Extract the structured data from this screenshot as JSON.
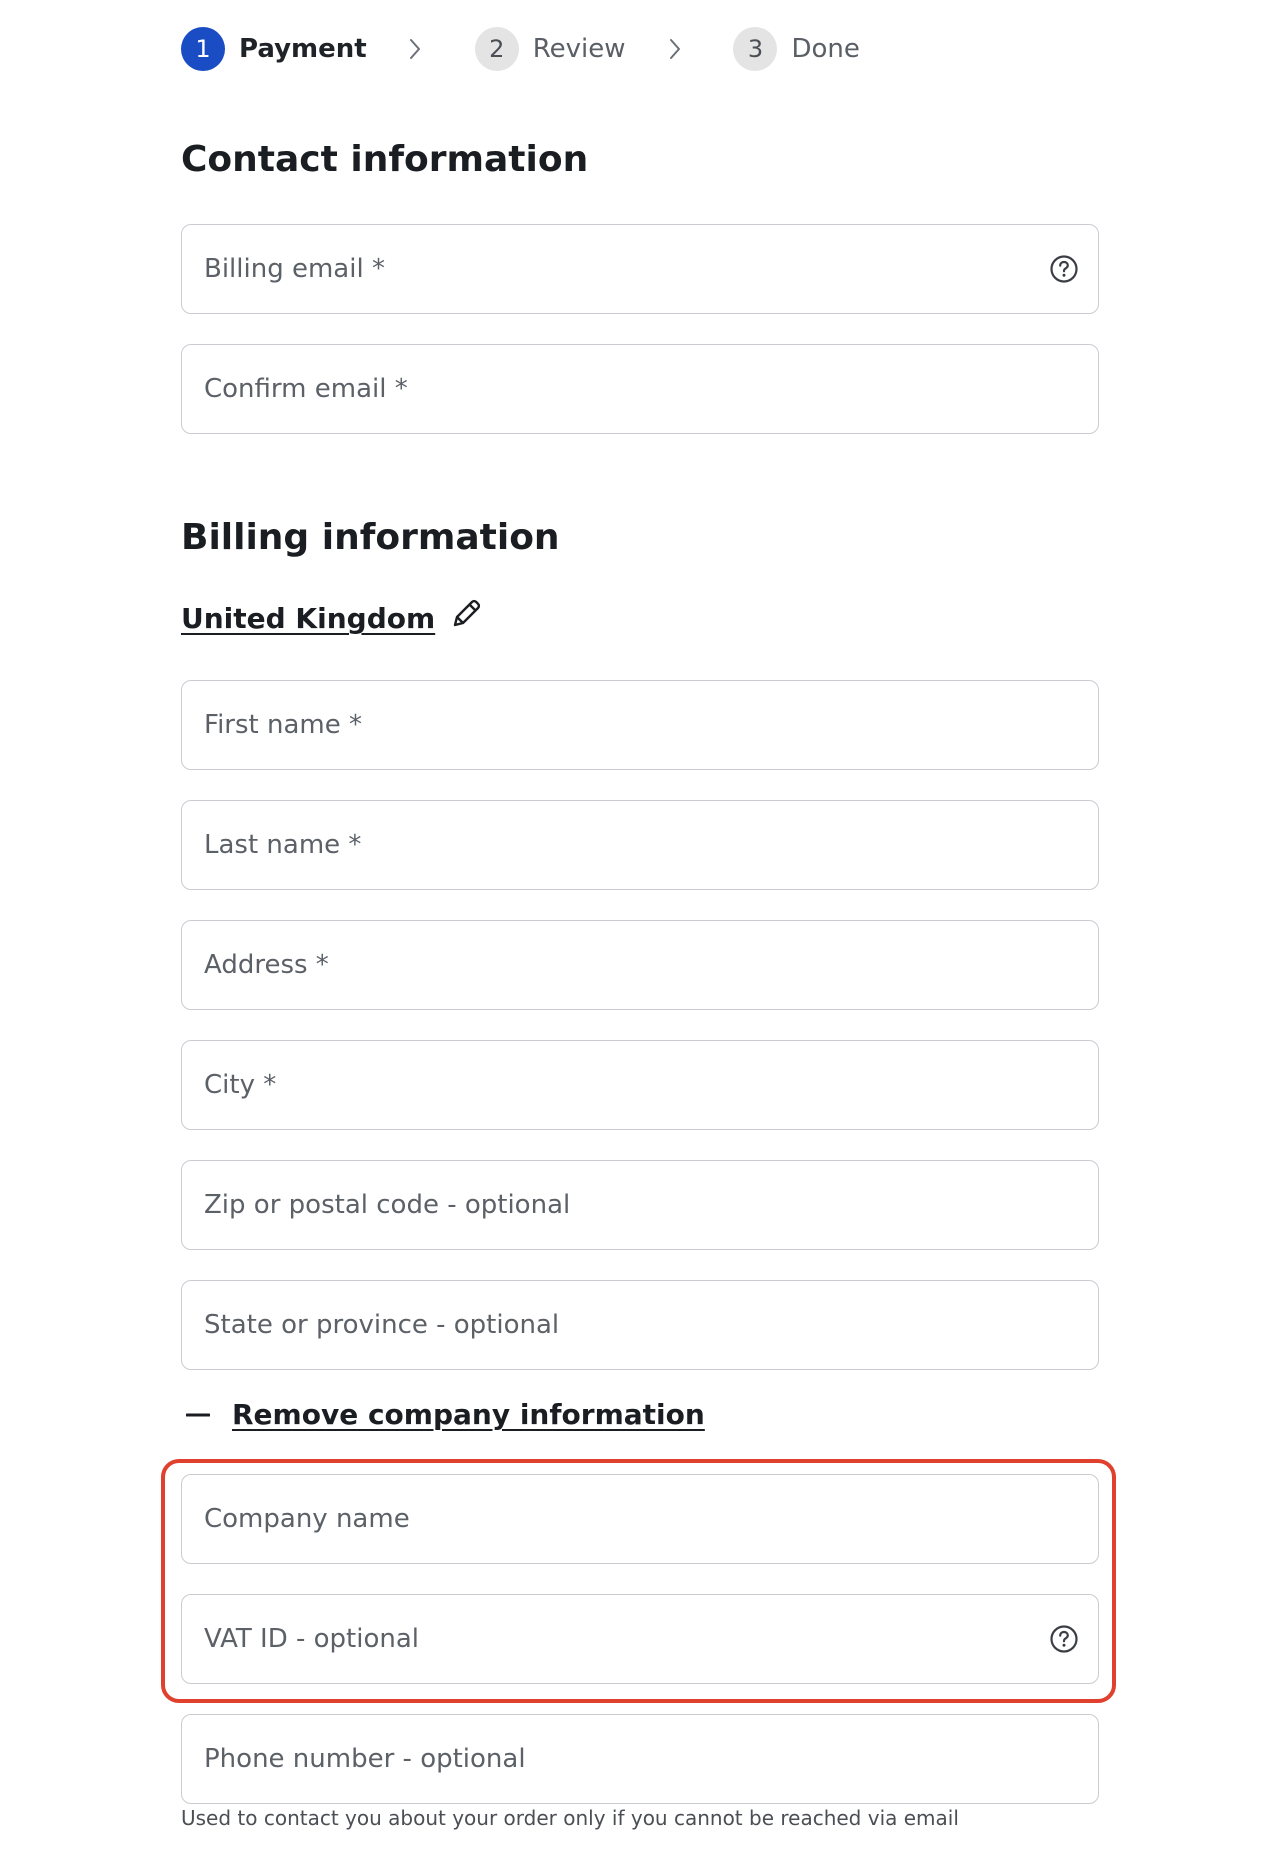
{
  "stepper": {
    "steps": [
      {
        "number": "1",
        "label": "Payment",
        "active": true
      },
      {
        "number": "2",
        "label": "Review",
        "active": false
      },
      {
        "number": "3",
        "label": "Done",
        "active": false
      }
    ]
  },
  "contact": {
    "title": "Contact information",
    "billing_email_placeholder": "Billing email *",
    "confirm_email_placeholder": "Confirm email *"
  },
  "billing": {
    "title": "Billing information",
    "country": "United Kingdom",
    "first_name_placeholder": "First name *",
    "last_name_placeholder": "Last name *",
    "address_placeholder": "Address *",
    "city_placeholder": "City *",
    "zip_placeholder": "Zip or postal code - optional",
    "state_placeholder": "State or province - optional",
    "remove_company_label": "Remove company information",
    "company_name_placeholder": "Company name",
    "vat_placeholder": "VAT ID - optional",
    "phone_placeholder": "Phone number - optional",
    "phone_helper": "Used to contact you about your order only if you cannot be reached via email"
  },
  "colors": {
    "accent": "#1a4cc4",
    "highlight": "#e0402e",
    "field_border": "#c9ccd1"
  },
  "icons": {
    "help": "question-circle-icon",
    "edit": "pencil-icon",
    "step_separator": "chevron-right-icon",
    "collapse": "minus-icon"
  }
}
